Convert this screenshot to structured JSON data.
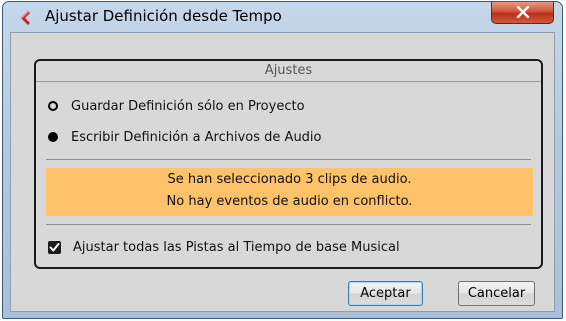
{
  "window": {
    "title": "Ajustar Definición desde Tempo",
    "close_symbol": "X"
  },
  "settings": {
    "group_title": "Ajustes",
    "options": [
      {
        "label": "Guardar Definición sólo en Proyecto",
        "selected": false
      },
      {
        "label": "Escribir Definición a Archivos de Audio",
        "selected": true
      }
    ],
    "notice_lines": [
      "Se han seleccionado 3 clips de audio.",
      "No hay eventos de audio en conflicto."
    ],
    "checkbox": {
      "label": "Ajustar todas las Pistas al Tiempo de base Musical",
      "checked": true
    }
  },
  "buttons": {
    "accept_label": "Aceptar",
    "cancel_label": "Cancelar"
  },
  "colors": {
    "notice_background": "#fdc26a",
    "close_button": "#c94a30",
    "app_icon": "#c8202c"
  }
}
